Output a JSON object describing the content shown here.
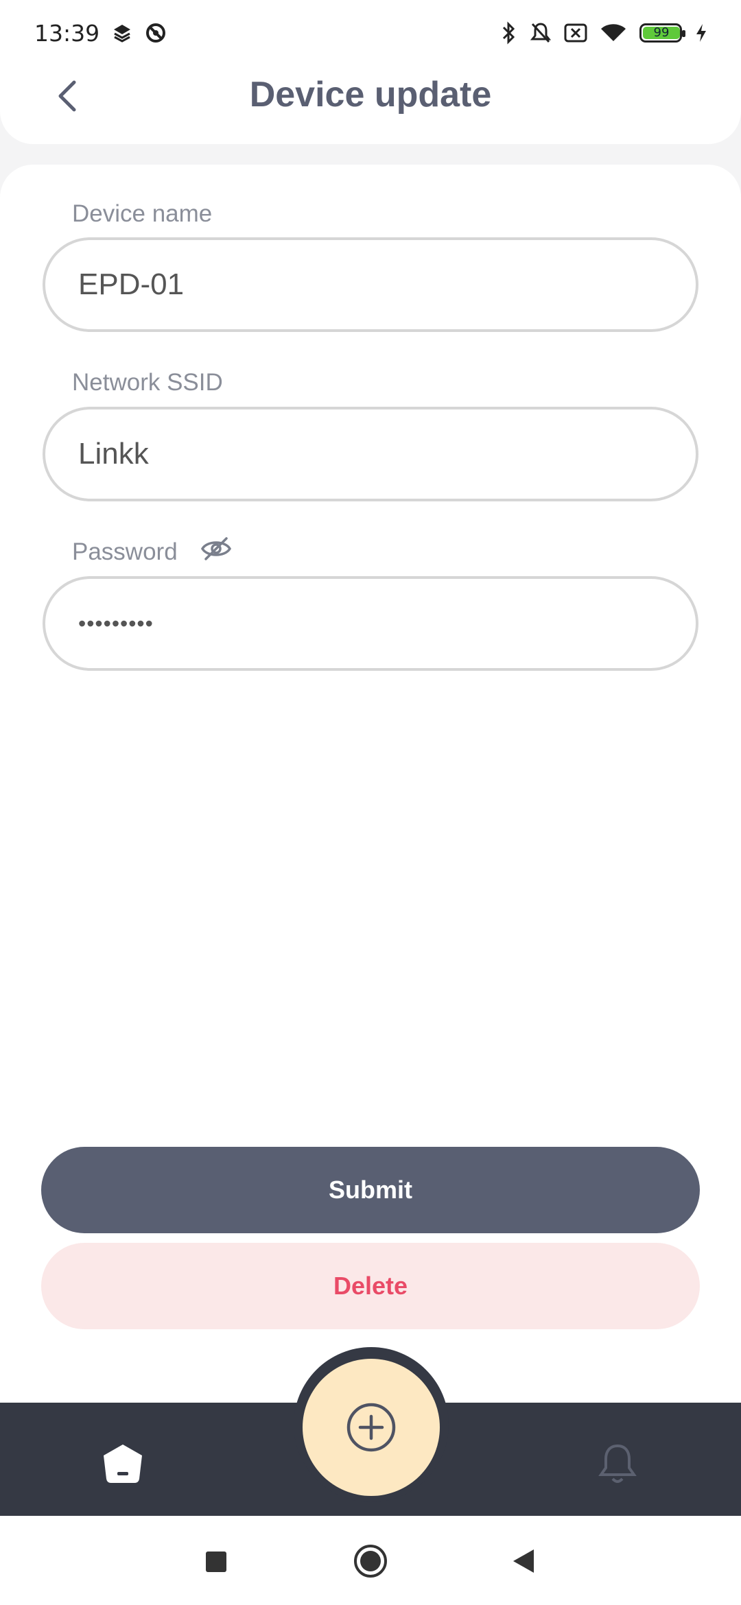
{
  "status_bar": {
    "time": "13:39",
    "battery": "99",
    "left_icons": [
      "layers-icon",
      "block-icon"
    ],
    "right_icons": [
      "bluetooth-icon",
      "bell-off-icon",
      "sim-x-icon",
      "wifi-icon",
      "battery-icon",
      "charging-icon"
    ]
  },
  "header": {
    "title": "Device update",
    "back_icon": "chevron-left-icon"
  },
  "form": {
    "device_name_label": "Device name",
    "device_name_value": "EPD-01",
    "ssid_label": "Network SSID",
    "ssid_value": "Linkk",
    "password_label": "Password",
    "password_value": "•••••••••",
    "password_toggle_icon": "eye-off-icon"
  },
  "actions": {
    "submit_label": "Submit",
    "delete_label": "Delete"
  },
  "bottom_nav": {
    "home_icon": "home-icon",
    "add_icon": "plus-circle-icon",
    "notifications_icon": "bell-icon"
  },
  "colors": {
    "primary": "#595f72",
    "danger": "#e94b67",
    "danger_bg": "#fbe8e8",
    "nav_bg": "#353944",
    "fab_bg": "#fde8c2"
  }
}
